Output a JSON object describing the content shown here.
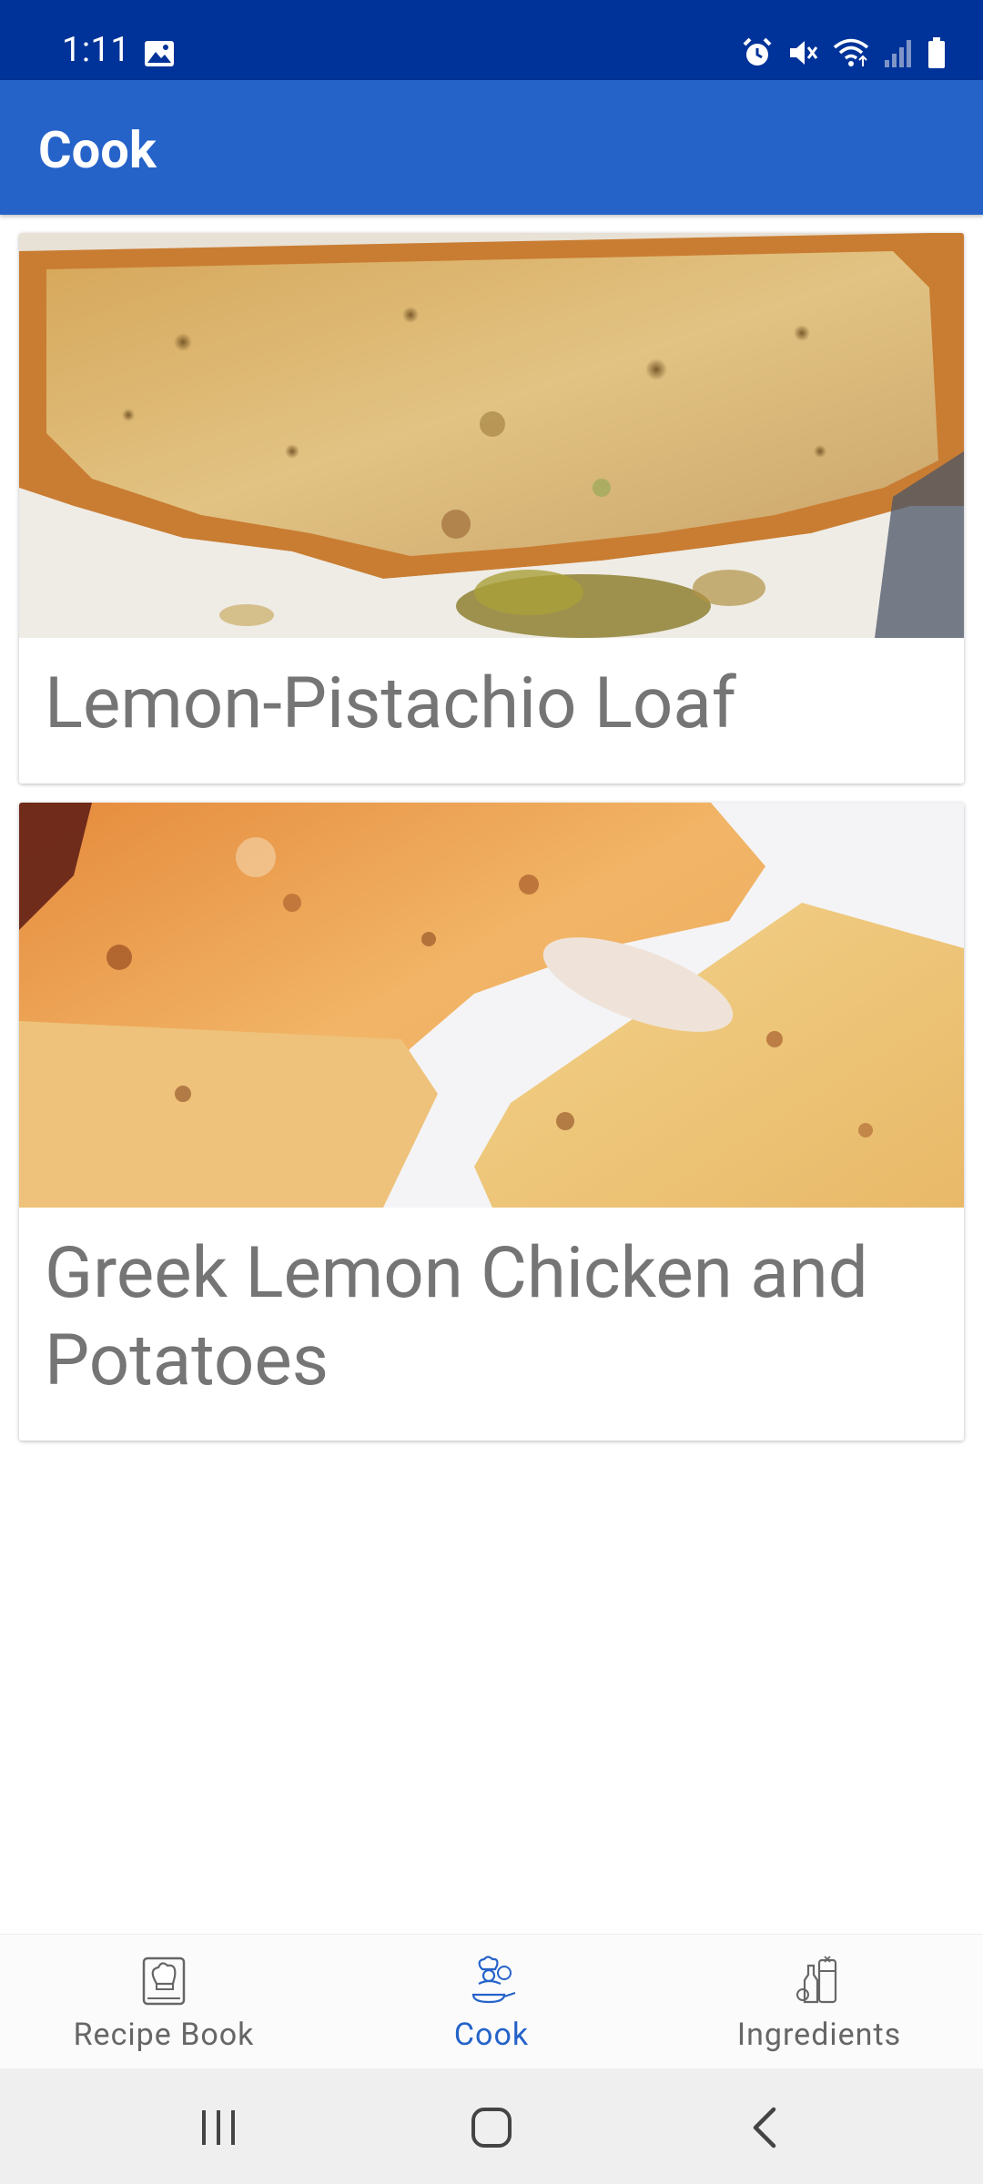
{
  "status_bar": {
    "time": "1:11",
    "icons": [
      "gallery-icon",
      "alarm-icon",
      "mute-icon",
      "wifi-icon",
      "signal-icon",
      "battery-icon"
    ],
    "background_color": "#003399"
  },
  "app_bar": {
    "title": "Cook",
    "background_color": "#2563c9"
  },
  "recipes": [
    {
      "title": "Lemon-Pistachio Loaf",
      "image": "lemon-pistachio-loaf-photo"
    },
    {
      "title": "Greek Lemon Chicken and Potatoes",
      "image": "greek-lemon-chicken-photo"
    }
  ],
  "bottom_nav": {
    "items": [
      {
        "label": "Recipe Book",
        "icon": "recipe-book-icon",
        "selected": false
      },
      {
        "label": "Cook",
        "icon": "cook-icon",
        "selected": true
      },
      {
        "label": "Ingredients",
        "icon": "ingredients-icon",
        "selected": false
      }
    ],
    "selected_color": "#2563c9"
  },
  "system_nav": {
    "buttons": [
      "recents-button",
      "home-button",
      "back-button"
    ]
  }
}
